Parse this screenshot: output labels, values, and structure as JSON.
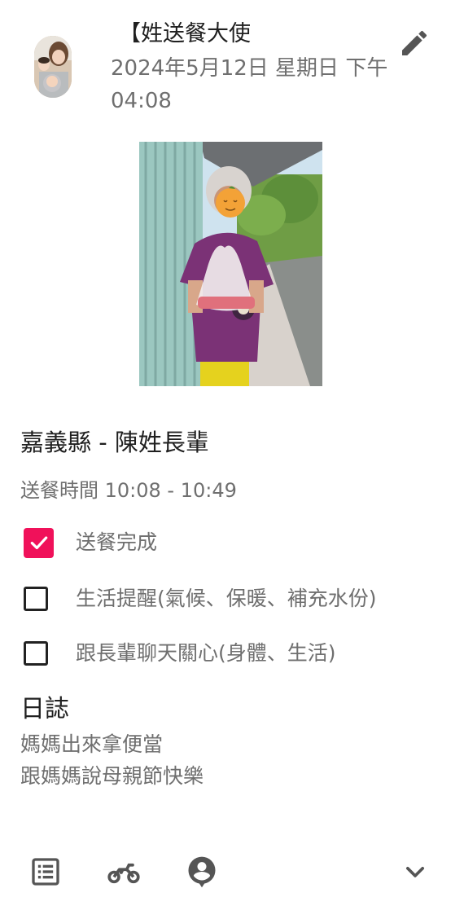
{
  "header": {
    "author": "【姓送餐大使",
    "timestamp": "2024年5月12日 星期日 下午04:08",
    "edit_icon": "pencil-icon"
  },
  "post": {
    "title": "嘉義縣 - 陳姓長輩",
    "meal_time": "送餐時間 10:08 - 10:49",
    "checklist": [
      {
        "label": "送餐完成",
        "checked": true
      },
      {
        "label": "生活提醒(氣候、保暖、補充水份)",
        "checked": false
      },
      {
        "label": "跟長輩聊天關心(身體、生活)",
        "checked": false
      }
    ],
    "log_heading": "日誌",
    "log_lines": [
      "媽媽出來拿便當",
      "跟媽媽說母親節快樂"
    ]
  },
  "actions": {
    "icons": [
      "list-icon",
      "motorcycle-icon",
      "person-pin-icon",
      "chevron-down-icon"
    ]
  },
  "colors": {
    "accent": "#f0115a",
    "primary_text": "#202020",
    "secondary_text": "#6f6f6f",
    "icon": "#555555"
  }
}
